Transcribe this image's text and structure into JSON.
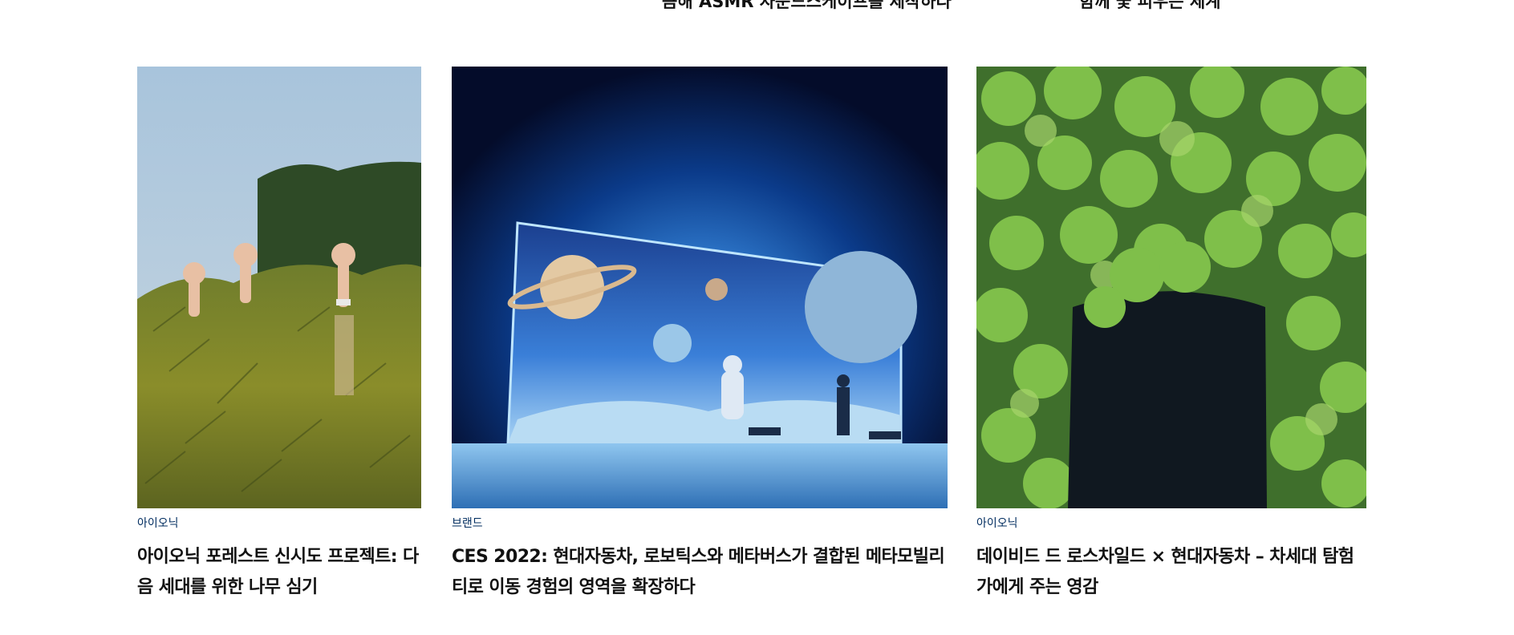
{
  "previous_row": {
    "title_left": "큼해 ASMR 사운드스케이프를 제작하다",
    "title_right": "함께 꽃 피우는 세계"
  },
  "cards": [
    {
      "category": "아이오닉",
      "title": "아이오닉 포레스트 신시도 프로젝트: 다음 세대를 위한 나무 심기",
      "image_alt": "hands-raised-in-pine-trees"
    },
    {
      "category": "브랜드",
      "title": "CES 2022: 현대자동차, 로보틱스와 메타버스가 결합된 메타모빌리티로 이동 경험의 영역을 확장하다",
      "image_alt": "astronaut-and-robot-dogs-before-space-screen"
    },
    {
      "category": "아이오닉",
      "title": "데이비드 드 로스차일드 × 현대자동차 – 차세대 탐험가에게 주는 영감",
      "image_alt": "man-hidden-behind-green-vine-leaves"
    }
  ]
}
